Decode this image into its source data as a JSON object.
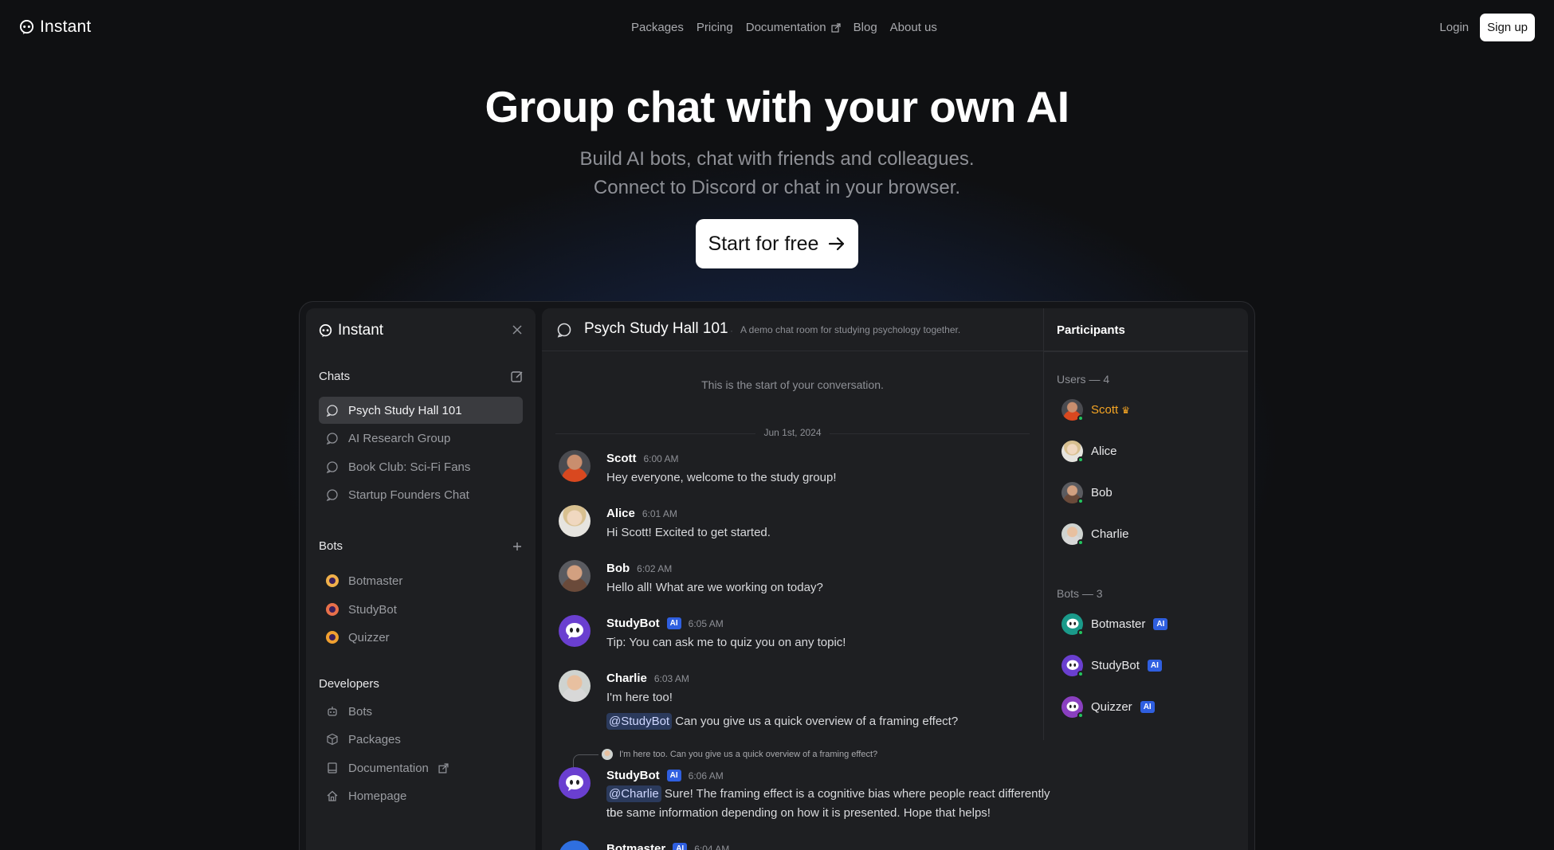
{
  "nav": {
    "brand": "Instant",
    "links": [
      {
        "label": "Packages"
      },
      {
        "label": "Pricing"
      },
      {
        "label": "Documentation",
        "external": true
      },
      {
        "label": "Blog"
      },
      {
        "label": "About us"
      }
    ],
    "login": "Login",
    "signup": "Sign up"
  },
  "hero": {
    "title": "Group chat with your own AI",
    "subtitle_line1": "Build AI bots, chat with friends and colleagues.",
    "subtitle_line2": "Connect to Discord or chat in your browser.",
    "cta": "Start for free"
  },
  "sidebar": {
    "brand": "Instant",
    "chats_title": "Chats",
    "chats": [
      {
        "label": "Psych Study Hall 101",
        "active": true
      },
      {
        "label": "AI Research Group"
      },
      {
        "label": "Book Club: Sci-Fi Fans"
      },
      {
        "label": "Startup Founders Chat"
      }
    ],
    "bots_title": "Bots",
    "bots": [
      {
        "label": "Botmaster"
      },
      {
        "label": "StudyBot"
      },
      {
        "label": "Quizzer"
      }
    ],
    "developers_title": "Developers",
    "developers": [
      {
        "label": "Bots",
        "icon": "robot-icon"
      },
      {
        "label": "Packages",
        "icon": "package-icon"
      },
      {
        "label": "Documentation",
        "icon": "book-icon"
      },
      {
        "label": "Homepage",
        "icon": "home-icon"
      }
    ]
  },
  "chat": {
    "title": "Psych Study Hall 101",
    "separator": "·",
    "description": "A demo chat room for studying psychology together.",
    "start_text": "This is the start of your conversation.",
    "date": "Jun 1st, 2024",
    "messages": [
      {
        "name": "Scott",
        "time": "6:00 AM",
        "text": "Hey everyone, welcome to the study group!"
      },
      {
        "name": "Alice",
        "time": "6:01 AM",
        "text": "Hi Scott! Excited to get started."
      },
      {
        "name": "Bob",
        "time": "6:02 AM",
        "text": "Hello all! What are we working on today?"
      },
      {
        "name": "StudyBot",
        "badge": "AI",
        "time": "6:05 AM",
        "text": "Tip: You can ask me to quiz you on any topic!"
      },
      {
        "name": "Charlie",
        "time": "6:03 AM",
        "text": "I'm here too!",
        "mention": "@StudyBot",
        "text2": "Can you give us a quick overview of a framing effect?"
      },
      {
        "reply_preview": "I'm here too. Can you give us a quick overview of a framing effect?",
        "name": "StudyBot",
        "badge": "AI",
        "time": "6:06 AM",
        "mention": "@Charlie",
        "text": "Sure! The framing effect is a cognitive bias where people react differently to",
        "text2": "the same information depending on how it is presented. Hope that helps!"
      },
      {
        "name": "Botmaster",
        "badge": "AI",
        "time": "6:04 AM"
      }
    ]
  },
  "participants": {
    "title": "Participants",
    "users_title": "Users — 4",
    "users": [
      {
        "name": "Scott",
        "owner": true,
        "crown": "♛"
      },
      {
        "name": "Alice"
      },
      {
        "name": "Bob"
      },
      {
        "name": "Charlie"
      }
    ],
    "bots_title": "Bots — 3",
    "bots": [
      {
        "name": "Botmaster",
        "badge": "AI"
      },
      {
        "name": "StudyBot",
        "badge": "AI"
      },
      {
        "name": "Quizzer",
        "badge": "AI"
      }
    ]
  },
  "colors": {
    "accent_owner": "#f5a524",
    "ai_badge": "#2f5fe0",
    "online": "#23c55e"
  }
}
